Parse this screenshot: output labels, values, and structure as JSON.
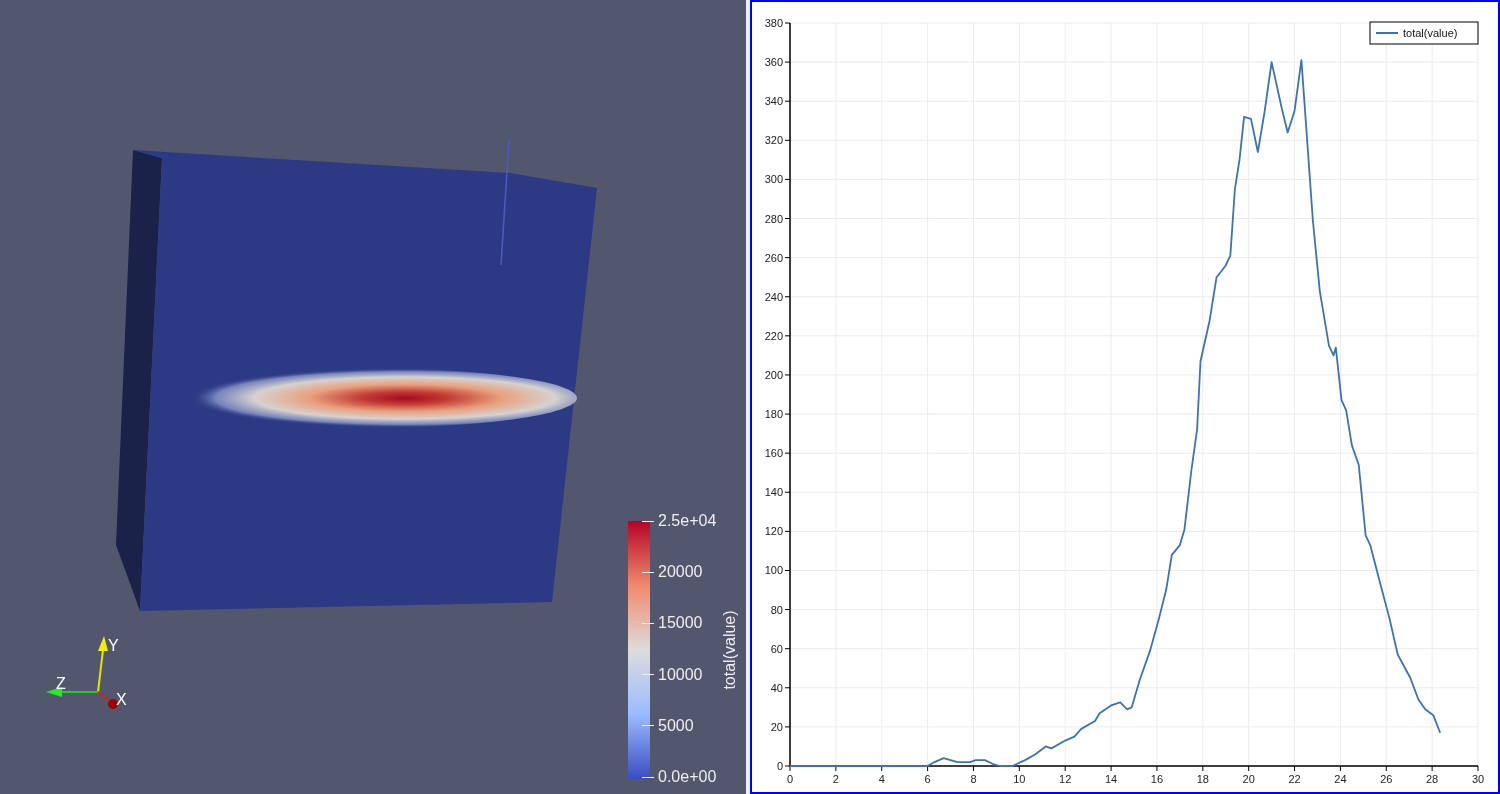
{
  "render_view": {
    "colorbar": {
      "title": "total(value)",
      "labels": [
        "2.5e+04",
        "20000",
        "15000",
        "10000",
        "5000",
        "0.0e+00"
      ]
    },
    "orientation_axes": {
      "x_label": "X",
      "y_label": "Y",
      "z_label": "Z"
    }
  },
  "line_chart": {
    "chart_data": {
      "type": "line",
      "x": [
        0,
        6.0,
        6.3,
        6.7,
        7.0,
        7.3,
        7.85,
        8.1,
        8.5,
        8.85,
        9.15,
        9.7,
        10.25,
        10.7,
        11.15,
        11.4,
        12.0,
        12.4,
        12.7,
        13.3,
        13.5,
        14.0,
        14.4,
        14.7,
        14.9,
        15.25,
        15.7,
        16.1,
        16.4,
        16.65,
        17.0,
        17.2,
        17.5,
        17.75,
        17.9,
        18.3,
        18.6,
        19.0,
        19.2,
        19.4,
        19.6,
        19.8,
        20.1,
        20.4,
        20.7,
        21.0,
        21.45,
        21.7,
        22.0,
        22.3,
        22.8,
        23.1,
        23.5,
        23.7,
        23.8,
        24.05,
        24.25,
        24.5,
        24.8,
        25.1,
        25.3,
        25.7,
        26.15,
        26.5,
        27.05,
        27.4,
        27.7,
        28.05,
        28.35
      ],
      "series": [
        {
          "name": "total(value)",
          "color": "#3a74b4",
          "values": [
            0,
            0,
            2,
            4,
            3,
            2,
            2,
            3,
            3,
            1,
            0,
            0,
            3,
            6,
            10,
            9,
            13,
            15,
            19,
            23,
            27,
            31,
            32.5,
            29,
            30,
            44,
            59,
            76,
            90,
            108,
            113,
            121,
            151,
            172,
            207,
            228,
            250,
            256,
            261,
            295,
            310,
            332,
            331,
            314,
            335,
            360,
            336,
            324,
            335,
            361,
            279,
            243,
            215,
            210,
            214,
            187,
            182,
            164,
            154,
            118,
            113,
            95,
            75,
            57,
            45,
            34,
            29,
            26,
            17
          ]
        }
      ],
      "grid": true,
      "xlim": [
        0,
        30
      ],
      "ylim": [
        0,
        380
      ],
      "xticks": [
        0,
        2,
        4,
        6,
        8,
        10,
        12,
        14,
        16,
        18,
        20,
        22,
        24,
        26,
        28,
        30
      ],
      "yticks": [
        0,
        20,
        40,
        60,
        80,
        100,
        120,
        140,
        160,
        180,
        200,
        220,
        240,
        260,
        280,
        300,
        320,
        340,
        360,
        380
      ]
    }
  }
}
